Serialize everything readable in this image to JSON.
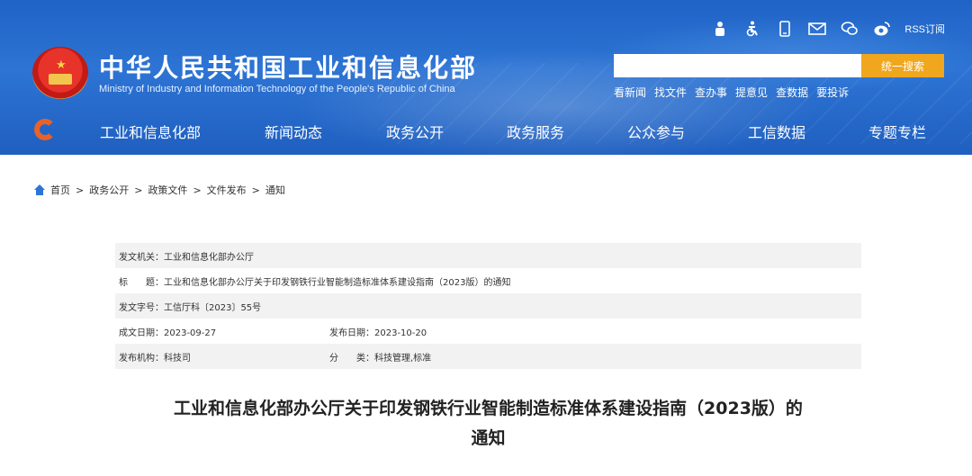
{
  "header": {
    "title": "中华人民共和国工业和信息化部",
    "subtitle": "Ministry of Industry and Information Technology of the People's Republic of China",
    "utility_icons": [
      "robot-icon",
      "accessibility-icon",
      "mobile-icon",
      "mail-icon",
      "wechat-icon",
      "weibo-icon"
    ],
    "rss_label": "RSS订阅",
    "search": {
      "placeholder": "",
      "button_label": "统一搜索"
    },
    "quick_links": [
      "看新闻",
      "找文件",
      "查办事",
      "提意见",
      "查数据",
      "要投诉"
    ]
  },
  "nav": {
    "items": [
      "工业和信息化部",
      "新闻动态",
      "政务公开",
      "政务服务",
      "公众参与",
      "工信数据",
      "专题专栏"
    ]
  },
  "breadcrumb": {
    "items": [
      "首页",
      "政务公开",
      "政策文件",
      "文件发布",
      "通知"
    ],
    "separator": ">"
  },
  "meta": {
    "issuer": "发文机关：工业和信息化部办公厅",
    "subject": "标　　题：工业和信息化部办公厅关于印发钢铁行业智能制造标准体系建设指南（2023版）的通知",
    "doc_number": "发文字号：工信厅科〔2023〕55号",
    "created_date": "成文日期：2023-09-27",
    "publish_date": "发布日期：2023-10-20",
    "publisher": "发布机构：科技司",
    "category": "分　　类：科技管理,标准"
  },
  "document": {
    "title_line1": "工业和信息化部办公厅关于印发钢铁行业智能制造标准体系建设指南（2023版）的",
    "title_line2": "通知"
  },
  "colors": {
    "header_blue": "#2d74d4",
    "search_button": "#f0a71e",
    "row_shade": "#f2f2f2"
  }
}
